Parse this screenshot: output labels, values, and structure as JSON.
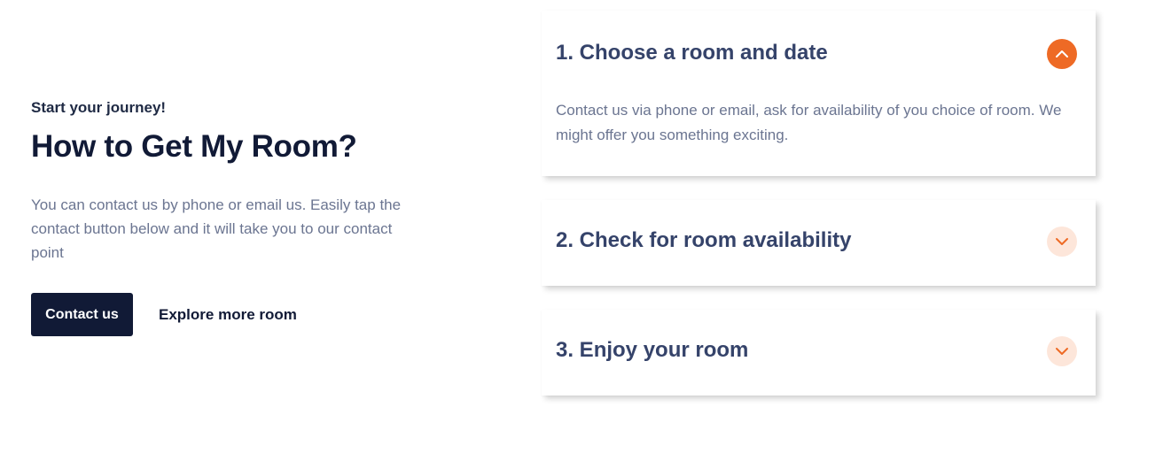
{
  "intro": {
    "eyebrow": "Start your journey!",
    "heading": "How to Get My Room?",
    "description": "You can contact us by phone or email us. Easily tap the contact button below and it will take you to our contact point",
    "primary_button": "Contact us",
    "secondary_link": "Explore more room"
  },
  "accordion": {
    "items": [
      {
        "title": "1. Choose a room and date",
        "body": "Contact us via phone or email, ask for availability of you choice of room. We might offer you something exciting.",
        "expanded": true,
        "icon": "chevron-up-icon"
      },
      {
        "title": "2. Check for room availability",
        "body": "",
        "expanded": false,
        "icon": "chevron-down-icon"
      },
      {
        "title": "3. Enjoy your room",
        "body": "",
        "expanded": false,
        "icon": "chevron-down-icon"
      }
    ]
  },
  "colors": {
    "accent": "#ee6a25",
    "accent_light": "#fde6da",
    "navy": "#111a36",
    "title_text": "#35436a",
    "muted_text": "#6b7591"
  }
}
